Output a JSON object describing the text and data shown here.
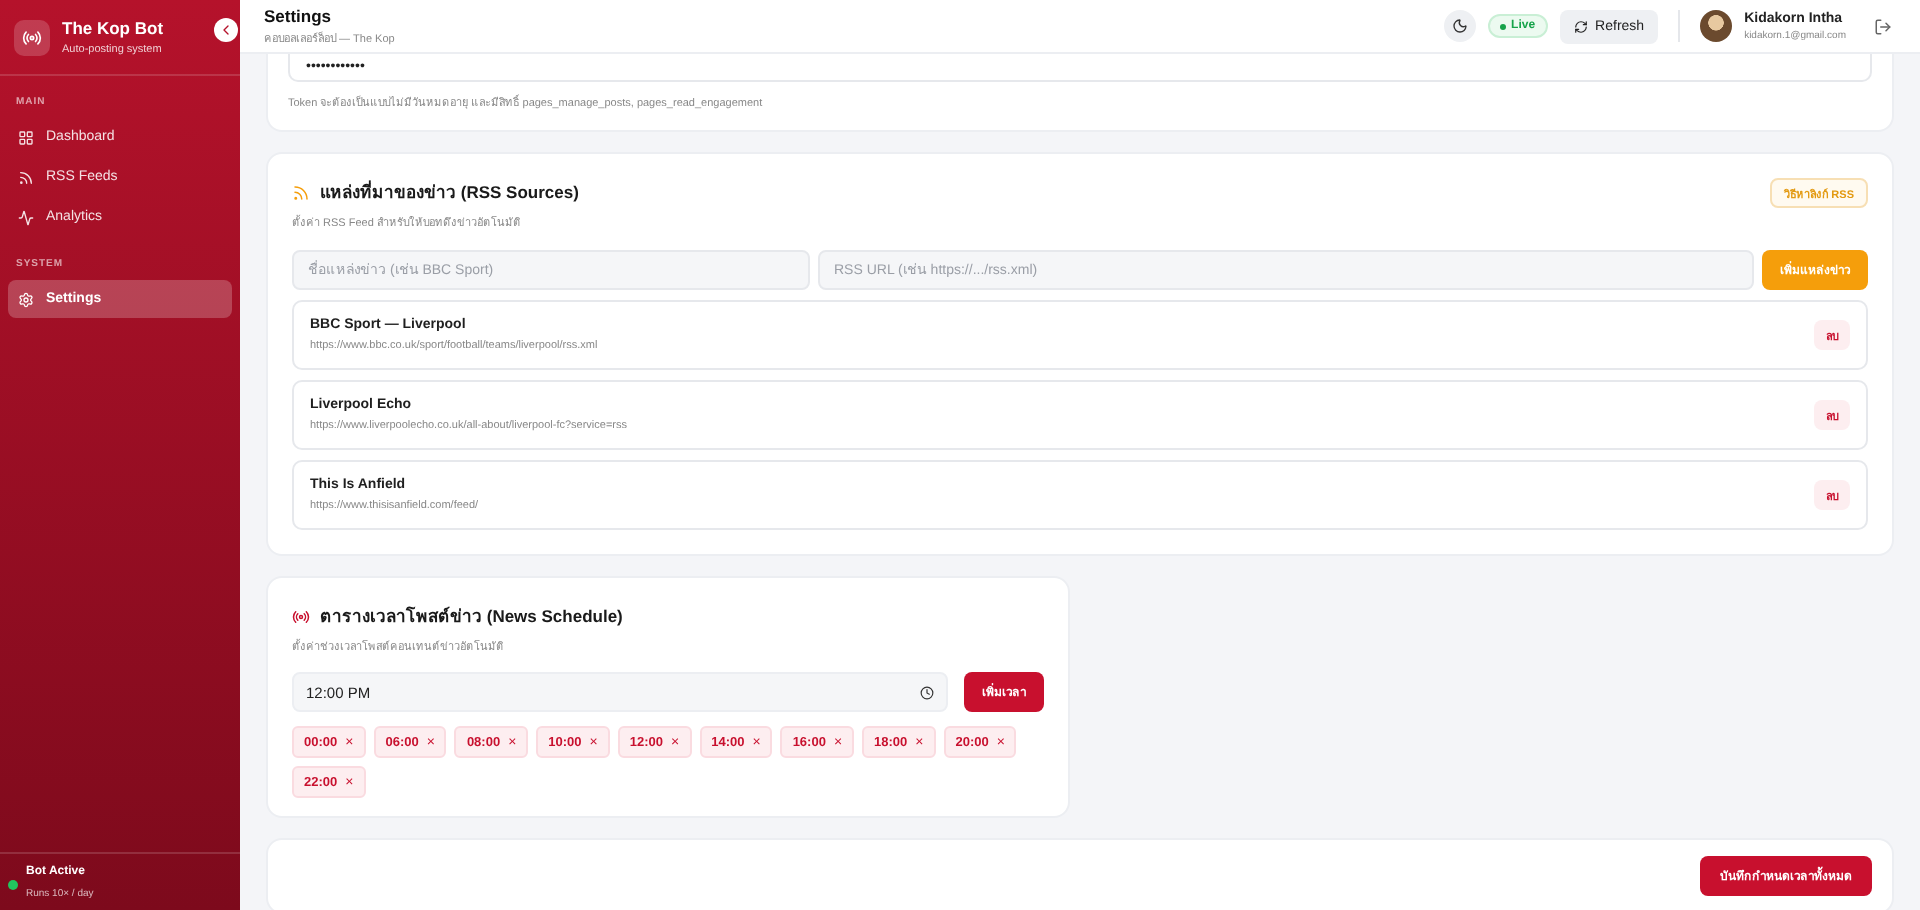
{
  "sidebar": {
    "brand": {
      "title": "The Kop Bot",
      "subtitle": "Auto-posting system"
    },
    "sections": [
      {
        "label": "MAIN",
        "items": [
          {
            "label": "Dashboard",
            "selected": false
          },
          {
            "label": "RSS Feeds",
            "selected": false
          },
          {
            "label": "Analytics",
            "selected": false
          }
        ]
      },
      {
        "label": "SYSTEM",
        "items": [
          {
            "label": "Settings",
            "selected": true
          }
        ]
      }
    ],
    "status": {
      "title": "Bot Active",
      "detail": "Runs 10× / day",
      "active": true
    }
  },
  "header": {
    "title": "Settings",
    "subtitle": "คอบอลเลอร์ล็อป — The Kop",
    "live": "Live",
    "refresh": "Refresh",
    "user": {
      "name": "Kidakorn Intha",
      "email": "kidakorn.1@gmail.com"
    }
  },
  "token_card": {
    "value": "••••••••••••",
    "hint": "Token จะต้องเป็นแบบไม่มีวันหมดอายุ และมีสิทธิ์ pages_manage_posts, pages_read_engagement"
  },
  "rss_card": {
    "title": "แหล่งที่มาของข่าว (RSS Sources)",
    "subtitle": "ตั้งค่า RSS Feed สำหรับให้บอทดึงข่าวอัตโนมัติ",
    "help_button": "วิธีหาลิงก์ RSS",
    "name_placeholder": "ชื่อแหล่งข่าว (เช่น BBC Sport)",
    "url_placeholder": "RSS URL (เช่น https://.../rss.xml)",
    "add_button": "เพิ่มแหล่งข่าว",
    "sources": [
      {
        "name": "BBC Sport — Liverpool",
        "url": "https://www.bbc.co.uk/sport/football/teams/liverpool/rss.xml",
        "delete": "ลบ"
      },
      {
        "name": "Liverpool Echo",
        "url": "https://www.liverpoolecho.co.uk/all-about/liverpool-fc?service=rss",
        "delete": "ลบ"
      },
      {
        "name": "This Is Anfield",
        "url": "https://www.thisisanfield.com/feed/",
        "delete": "ลบ"
      }
    ]
  },
  "schedule_card": {
    "title": "ตารางเวลาโพสต์ข่าว (News Schedule)",
    "subtitle": "ตั้งค่าช่วงเวลาโพสต์คอนเทนต์ข่าวอัตโนมัติ",
    "time_value": "12:00 PM",
    "add_button": "เพิ่มเวลา",
    "times": [
      {
        "label": "00:00",
        "remove": "×"
      },
      {
        "label": "06:00",
        "remove": "×"
      },
      {
        "label": "08:00",
        "remove": "×"
      },
      {
        "label": "10:00",
        "remove": "×"
      },
      {
        "label": "12:00",
        "remove": "×"
      },
      {
        "label": "14:00",
        "remove": "×"
      },
      {
        "label": "16:00",
        "remove": "×"
      },
      {
        "label": "18:00",
        "remove": "×"
      },
      {
        "label": "20:00",
        "remove": "×"
      },
      {
        "label": "22:00",
        "remove": "×"
      }
    ]
  },
  "footer": {
    "save_button": "บันทึกกำหนดเวลาทั้งหมด"
  }
}
